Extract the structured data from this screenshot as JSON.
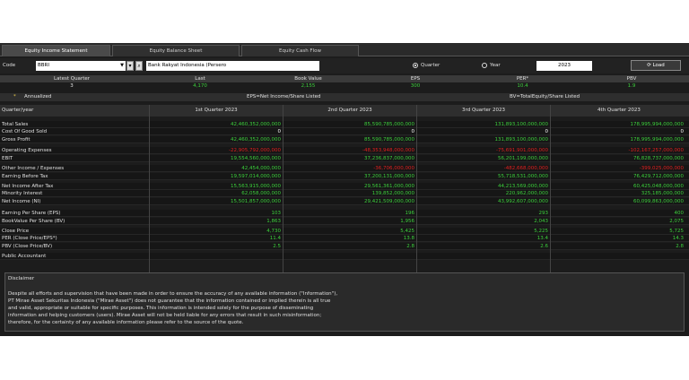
{
  "tabs": [
    {
      "label": "Equity Income Statement",
      "active": true
    },
    {
      "label": "Equity Balance Sheet",
      "active": false
    },
    {
      "label": "Equity Cash Flow",
      "active": false
    }
  ],
  "controls": {
    "code_label": "Code",
    "code_value": "BBRI",
    "company_name": "Bank Rakyat Indonesia (Persero",
    "quarter_label": "Quarter",
    "year_label": "Year",
    "period_selected": "Quarter",
    "year_value": "2023",
    "load_label": "Load"
  },
  "summary": {
    "headers": [
      "Latest Quarter",
      "Last",
      "Book Value",
      "EPS",
      "PER*",
      "PBV"
    ],
    "values": [
      "3",
      "4,170",
      "2,155",
      "300",
      "10.4",
      "1.9"
    ]
  },
  "notes": {
    "annualized": "Annualized",
    "eps_formula": "EPS=Net Income/Share Listed",
    "bv_formula": "BV=TotalEquity/Share Listed"
  },
  "table": {
    "header_label": "Quarter/year",
    "columns": [
      "1st Quarter 2023",
      "2nd Quarter 2023",
      "3rd Quarter 2023",
      "4th Quarter 2023"
    ],
    "rows": [
      {
        "label": "Total Sales",
        "values": [
          "42,460,352,000,000",
          "85,590,785,000,000",
          "131,893,100,000,000",
          "178,995,994,000,000"
        ],
        "color": "green"
      },
      {
        "label": "Cost Of Good Sold",
        "values": [
          "0",
          "0",
          "0",
          "0"
        ],
        "color": "white"
      },
      {
        "label": "Gross Profit",
        "values": [
          "42,460,352,000,000",
          "85,590,785,000,000",
          "131,893,100,000,000",
          "178,995,994,000,000"
        ],
        "color": "green"
      },
      {
        "label": "Operating Expenses",
        "values": [
          "-22,905,792,000,000",
          "-48,353,948,000,000",
          "-75,691,901,000,000",
          "-102,167,257,000,000"
        ],
        "color": "red"
      },
      {
        "label": "EBIT",
        "values": [
          "19,554,560,000,000",
          "37,236,837,000,000",
          "56,201,199,000,000",
          "76,828,737,000,000"
        ],
        "color": "green"
      },
      {
        "label": "Other Income / Expenses",
        "values": [
          "42,454,000,000",
          "-36,706,000,000",
          "-482,668,000,000",
          "-399,025,000,000"
        ],
        "color": "mixed"
      },
      {
        "label": "Earning Before Tax",
        "values": [
          "19,597,014,000,000",
          "37,200,131,000,000",
          "55,718,531,000,000",
          "76,429,712,000,000"
        ],
        "color": "green"
      },
      {
        "label": "Net Income After Tax",
        "values": [
          "15,563,915,000,000",
          "29,561,361,000,000",
          "44,213,569,000,000",
          "60,425,048,000,000"
        ],
        "color": "green"
      },
      {
        "label": "Minority Interest",
        "values": [
          "62,058,000,000",
          "139,852,000,000",
          "220,962,000,000",
          "325,185,000,000"
        ],
        "color": "green"
      },
      {
        "label": "Net Income (NI)",
        "values": [
          "15,501,857,000,000",
          "29,421,509,000,000",
          "43,992,607,000,000",
          "60,099,863,000,000"
        ],
        "color": "green"
      },
      {
        "label": "Earning Per Share (EPS)",
        "values": [
          "103",
          "196",
          "293",
          "400"
        ],
        "color": "green"
      },
      {
        "label": "BookValue Per Share (BV)",
        "values": [
          "1,863",
          "1,956",
          "2,043",
          "2,075"
        ],
        "color": "green"
      },
      {
        "label": "Close Price",
        "values": [
          "4,730",
          "5,425",
          "5,225",
          "5,725"
        ],
        "color": "green"
      },
      {
        "label": "PER (Close Price/EPS*)",
        "values": [
          "11.4",
          "13.8",
          "13.4",
          "14.3"
        ],
        "color": "green"
      },
      {
        "label": "PBV (Close Price/BV)",
        "values": [
          "2.5",
          "2.8",
          "2.6",
          "2.8"
        ],
        "color": "green"
      },
      {
        "label": "Public Accountant",
        "values": [
          "",
          "",
          "",
          ""
        ],
        "color": "green"
      }
    ]
  },
  "disclaimer": {
    "title": "Disclaimer",
    "lines": [
      "Despite all efforts and supervision that have been made in order to ensure the accuracy of any available information (\"Information\"),",
      "PT Mirae Asset Sekuritas Indonesia (\"Mirae Asset\") does not guarantee that the information contained or implied therein is all true",
      "and valid, appropriate or suitable for specific purposes. This information is intended solely for the purpose of disseminating",
      "information and helping customers (users). Mirae Asset will not be held liable for any errors that result in such misinformation;",
      "therefore, for the certainty of any available information please refer to the source of the quote."
    ]
  },
  "colors": {
    "green": "#3ccf3c",
    "red": "#e02020",
    "white": "#ffffff"
  }
}
